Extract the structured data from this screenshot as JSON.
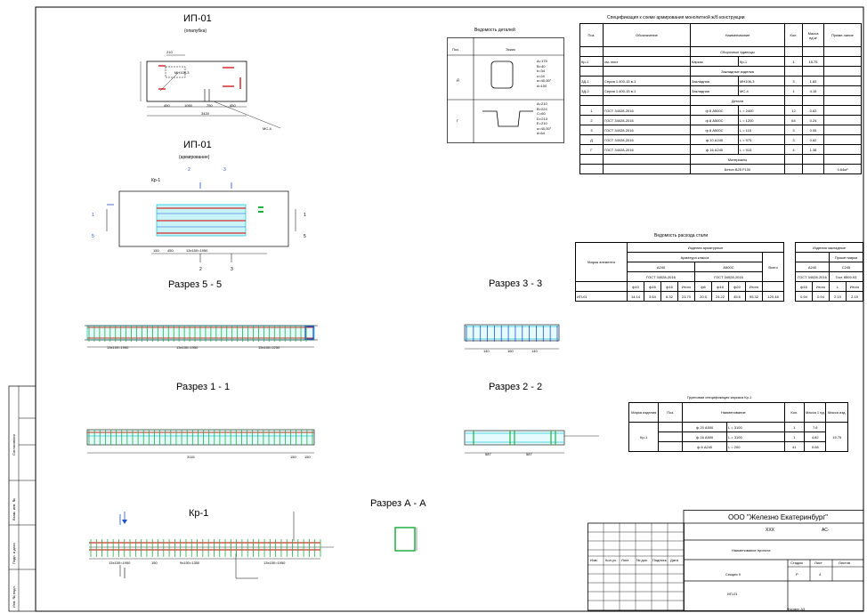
{
  "drawing_titles": {
    "ip01_formwork": "ИП-01",
    "ip01_formwork_sub": "(опалубка)",
    "ip01_rebar": "ИП-01",
    "ip01_rebar_sub": "(армирование)",
    "section_5_5": "Разрез 5 - 5",
    "section_3_3": "Разрез 3 - 3",
    "section_1_1": "Разрез 1 - 1",
    "section_2_2": "Разрез 2 - 2",
    "section_a_a": "Разрез А - А",
    "kr1": "Кр-1"
  },
  "formwork_labels": {
    "mn": "МН106-3",
    "mc": "МС-4",
    "dims_top": "210",
    "dims_bottom": [
      "450",
      "1050",
      "750",
      "450"
    ],
    "dims_total": "3420"
  },
  "rebar_labels": {
    "kr1_callout": "Кр-1",
    "cut_marks": [
      "2",
      "3",
      "1",
      "5",
      "1",
      "5",
      "2",
      "3"
    ],
    "dims": [
      "13х150=1950",
      "150",
      "450"
    ]
  },
  "section_dims": {
    "s55": [
      "13х150=1950",
      "13х150=1950",
      "15х150=2250"
    ],
    "s11": [
      "3115",
      "150",
      "150"
    ],
    "s33": [
      "140",
      "160",
      "140"
    ],
    "s22": [
      "587",
      "587"
    ],
    "kr1": [
      "13х150=1950",
      "9х150=1350",
      "13х150=1950",
      "150"
    ]
  },
  "bends": {
    "title": "Ведомость деталей",
    "headers": [
      "Поз.",
      "Эскиз"
    ],
    "rows": [
      {
        "pos": "Д",
        "params": [
          "А=175",
          "B=40",
          "h=34",
          "c=24",
          "α=40,00°",
          "d=100"
        ]
      },
      {
        "pos": "Г",
        "params": [
          "А=210",
          "B=224",
          "C=60",
          "D=213",
          "E=210",
          "α=40,00°",
          "d=64"
        ]
      }
    ]
  },
  "spec": {
    "title": "Спецификация к схеме армирования монолитной ж/б конструкции",
    "headers": [
      "Поз.",
      "Обозначение",
      "Наименование",
      "Кол.",
      "Масса ед.кг",
      "Приме-чание"
    ],
    "sections": [
      {
        "name": "Сборочные единицы",
        "rows": [
          {
            "pos": "Кр-1",
            "desig": "см. лист",
            "name_a": "Каркас",
            "name_b": "Кр-1",
            "qty": "1",
            "mass": "15.75"
          }
        ]
      },
      {
        "name": "Закладные изделия",
        "rows": [
          {
            "pos": "ЗД-1",
            "desig": "Серия 1.400-15 в.1",
            "name_a": "Закладная",
            "name_b": "МН106-3",
            "qty": "3",
            "mass": "1.83"
          },
          {
            "pos": "ЗД-2",
            "desig": "Серия 1.400-15 в.1",
            "name_a": "Закладная",
            "name_b": "МС-4",
            "qty": "1",
            "mass": "4.15"
          }
        ]
      },
      {
        "name": "Детали",
        "rows": [
          {
            "pos": "1",
            "desig": "ГОСТ 34028-2016",
            "name_a": "ф 8 А500С",
            "name_b": "L = 2400",
            "qty": "12",
            "mass": "0.63"
          },
          {
            "pos": "2",
            "desig": "ГОСТ 34028-2016",
            "name_a": "ф 8 А500С",
            "name_b": "L = 1200",
            "qty": "64",
            "mass": "0.24"
          },
          {
            "pos": "3",
            "desig": "ГОСТ 34028-2016",
            "name_a": "ф 8 А500С",
            "name_b": "L = 115",
            "qty": "3",
            "mass": "0.05"
          },
          {
            "pos": "Д",
            "desig": "ГОСТ 34028-2016",
            "name_a": "ф 10 А240",
            "name_b": "L = 975",
            "qty": "3",
            "mass": "0.62"
          },
          {
            "pos": "Г",
            "desig": "ГОСТ 34028-2016",
            "name_a": "ф 16 А240",
            "name_b": "L = 915",
            "qty": "4",
            "mass": "1.38"
          }
        ]
      },
      {
        "name": "Материалы",
        "rows": [
          {
            "pos": "",
            "desig": "",
            "name_a": "",
            "name_b": "Бетон В25 F100",
            "qty": "",
            "mass": "0.64м³"
          }
        ]
      }
    ]
  },
  "consumption": {
    "title": "Ведомость расхода стали",
    "col_element": "Марка элемента",
    "g1_title": "Изделия арматурные",
    "g1_sub": "Арматура класса",
    "cls_a": "А240",
    "cls_b": "А500С",
    "gost": "ГОСТ 34028-2016",
    "total": "Всего",
    "sub_a": [
      "ф10",
      "ф16",
      "ф16",
      "Итого"
    ],
    "sub_b": [
      "ф6",
      "ф16",
      "ф20",
      "Итого"
    ],
    "values_a": [
      "14.14",
      "3.54",
      "6.32",
      "23.70"
    ],
    "values_b": [
      "20.5",
      "24.22",
      "45.6",
      "95.32"
    ],
    "total_value": "120.48",
    "row_name": "ИП-01",
    "g2_title": "Изделия закладные",
    "g2_cls_a": "А240",
    "g2_cls_b": "С245",
    "g2_sub_a": "ГОСТ 34028-2016",
    "g2_sub_b": "Гост 8509-93",
    "g2_sub2": "Прокат марки",
    "g2_heads": [
      "ф16",
      "Итого",
      "L",
      "Итого"
    ],
    "g2_values": [
      "0.94",
      "0.94",
      "2.19",
      "2.19"
    ]
  },
  "group_spec": {
    "title": "Групповая спецификация каркаса Кр-1",
    "headers": [
      "Марка изделия",
      "Поз.",
      "Наименование",
      "Кол.",
      "Масса 1 ед.",
      "Масса изд."
    ],
    "mark": "Кр-1",
    "rows": [
      {
        "name_a": "ф 20 А500",
        "name_b": "L = 3100",
        "qty": "1",
        "mass": "7.6"
      },
      {
        "name_a": "ф 16 А500",
        "name_b": "L = 3100",
        "qty": "1",
        "mass": "4.82"
      },
      {
        "name_a": "ф 6 А240",
        "name_b": "L = 200",
        "qty": "41",
        "mass": "0.08"
      }
    ],
    "total_mass": "15.75"
  },
  "stamp": {
    "company": "ООО \"Железно Екатеринбург\"",
    "code": "ХХХ",
    "stage_code": "АС-",
    "project": "Наименование проекта",
    "section": "Секция Х",
    "drawing": "ИП-01",
    "head_stage": "Стадия",
    "head_sheet": "Лист",
    "head_sheets": "Листов",
    "stage": "Р",
    "sheet": "4",
    "cols": [
      "Изм.",
      "Кол.уч.",
      "Лист",
      "№ док.",
      "Подпись",
      "Дата"
    ],
    "format": "Формат А3"
  },
  "side_stamp": [
    "Согласовано",
    "Взам. инв. №",
    "Подп. и дата",
    "Инв. № подл."
  ],
  "colors": {
    "rebar_main": "#d42a2a",
    "stirrup": "#20b040",
    "cyan": "#29c8d8",
    "blue": "#2050d0"
  }
}
